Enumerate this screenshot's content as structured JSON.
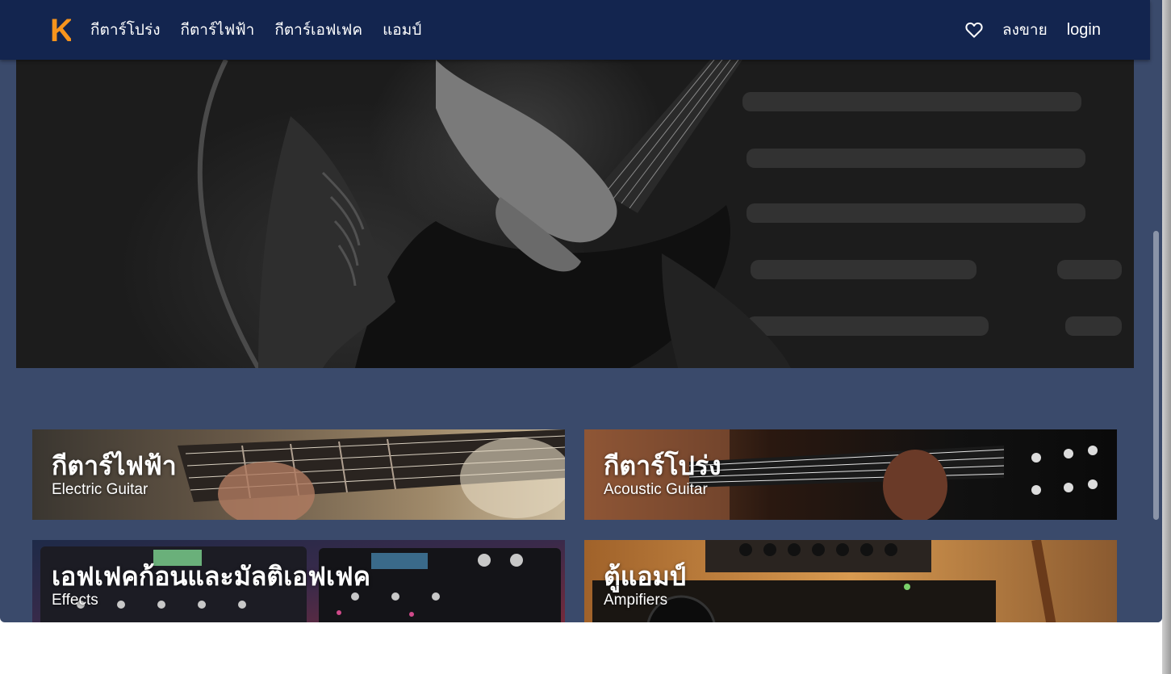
{
  "navbar": {
    "logo_letter": "K",
    "links": [
      {
        "label": "กีตาร์โปร่ง"
      },
      {
        "label": "กีตาร์ไฟฟ้า"
      },
      {
        "label": "กีตาร์เอฟเฟค"
      },
      {
        "label": "แอมป์"
      }
    ],
    "sell_label": "ลงขาย",
    "login_label": "login",
    "icons": {
      "favorites": "heart-icon"
    }
  },
  "categories": [
    {
      "title": "กีตาร์ไฟฟ้า",
      "subtitle": "Electric Guitar"
    },
    {
      "title": "กีตาร์โปร่ง",
      "subtitle": "Acoustic Guitar"
    },
    {
      "title": "เอฟเฟคก้อนและมัลติเอฟเฟค",
      "subtitle": "Effects"
    },
    {
      "title": "ตู้แอมป์",
      "subtitle": "Ampifiers"
    }
  ],
  "colors": {
    "navbar_bg": "#13254f",
    "page_bg": "#3a4a6b",
    "logo_accent": "#f7941d"
  }
}
